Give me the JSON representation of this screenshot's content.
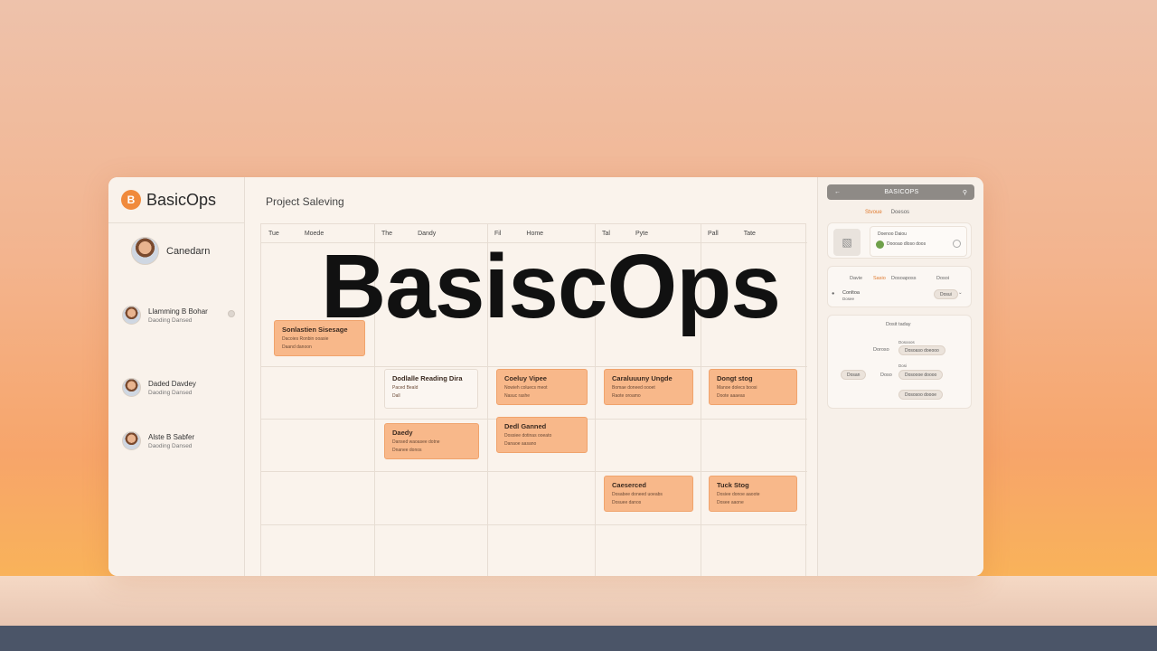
{
  "overlay": {
    "title": "BasiscOps"
  },
  "sidebar": {
    "brand_logo": "B",
    "brand_name": "BasicOps",
    "current_user": "Canedarn",
    "members": [
      {
        "name": "Llamming B Bohar",
        "role": "Daoding Dansed"
      },
      {
        "name": "Daded Davdey",
        "role": "Daoding Dansed"
      },
      {
        "name": "Alste B Sabfer",
        "role": "Daoding Dansed"
      }
    ]
  },
  "main": {
    "page_title": "Project Saleving",
    "columns": [
      {
        "day": "Tue",
        "name": "Moede"
      },
      {
        "day": "The",
        "name": "Dandy"
      },
      {
        "day": "Fil",
        "name": "Home"
      },
      {
        "day": "Tal",
        "name": "Pyte"
      },
      {
        "day": "Pall",
        "name": "Tate"
      }
    ],
    "tasks": [
      {
        "title": "Sonlastien Sisesage",
        "line1": "Dacoies Ronbin ooasie",
        "line2": "Daand danoon"
      },
      {
        "title": "Dodlalle Reading Dira",
        "line1": "Paced Beald",
        "line2": "Dall"
      },
      {
        "title": "Coeluy Vipee",
        "line1": "Nowieh coluecs meot",
        "line2": "Nasuc rashe"
      },
      {
        "title": "Caraluuuny Ungde",
        "line1": "Bomae doneed oooet",
        "line2": "Raote oroamo"
      },
      {
        "title": "Dongt stog",
        "line1": "Manoe dolecs boosi",
        "line2": "Doote aaaeas"
      },
      {
        "title": "Daedy",
        "line1": "Dansed waoasee dotne",
        "line2": "Dnanee donos"
      },
      {
        "title": "Dedl Ganned",
        "line1": "Dossiee dotinas ooeato",
        "line2": "Danaoe aasano"
      },
      {
        "title": "Caeserced",
        "line1": "Dosabee doneed uoeabs",
        "line2": "Dosuee danos"
      },
      {
        "title": "Tuck Stog",
        "line1": "Dosiee donoe aaoote",
        "line2": "Dosee aaone"
      }
    ]
  },
  "panel": {
    "bar_title": "BASICOPS",
    "tabs": [
      "Stvoue",
      "Doesos"
    ],
    "profile_name": "Doenoo Daiou",
    "profile_value": "Doooao dloso doos",
    "mini_tabs": [
      "Davie",
      "Sasio",
      "Dosoaposs",
      "Dosoi"
    ],
    "setting_label": "Conltoa",
    "setting_sub": "Dosee",
    "setting_value": "Dosui",
    "section_title": "Dosit taday",
    "field1_label": "Doroso",
    "field1_caption": "Dosooos",
    "field1_value": "Dosoaso doeooo",
    "field2_caption": "Dosi",
    "field2_left": "Dosan",
    "field2_mid": "Doso",
    "field2_value": "Dosoooe doooo",
    "field3_value": "Dososoo doooe"
  },
  "colors": {
    "accent": "#f08a3c",
    "task_fill": "#f8b88a",
    "status_green": "#6fa04a"
  }
}
